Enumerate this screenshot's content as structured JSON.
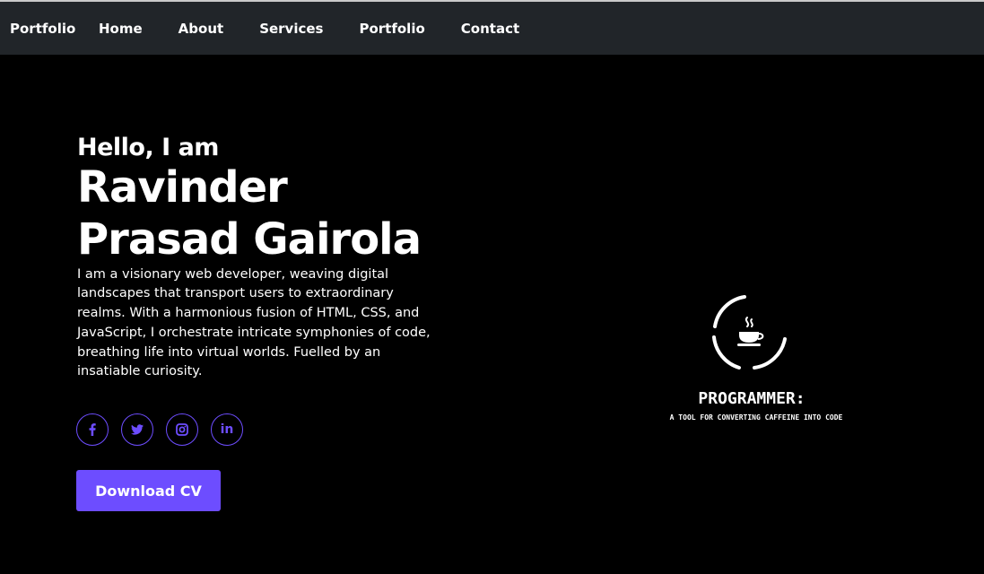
{
  "navbar": {
    "brand": "Portfolio",
    "links": [
      {
        "label": "Home"
      },
      {
        "label": "About"
      },
      {
        "label": "Services"
      },
      {
        "label": "Portfolio"
      },
      {
        "label": "Contact"
      }
    ]
  },
  "hero": {
    "greeting": "Hello, I am",
    "name_line1": "Ravinder",
    "name_line2": "Prasad Gairola",
    "bio": "I am a visionary web developer, weaving digital landscapes that transport users to extraordinary realms. With a harmonious fusion of HTML, CSS, and JavaScript, I orchestrate intricate symphonies of code, breathing life into virtual worlds. Fuelled by an insatiable curiosity.",
    "socials": [
      {
        "icon": "facebook-icon"
      },
      {
        "icon": "twitter-icon"
      },
      {
        "icon": "instagram-icon"
      },
      {
        "icon": "linkedin-icon",
        "text": "in"
      }
    ],
    "download_label": "Download CV"
  },
  "logo": {
    "title": "PROGRAMMER:",
    "tagline": "A TOOL FOR CONVERTING CAFFEINE INTO CODE",
    "icon": "coffee-cup-icon"
  },
  "colors": {
    "accent": "#6d4dff",
    "navbar_bg": "#212529",
    "page_bg": "#000000",
    "text": "#ffffff"
  }
}
